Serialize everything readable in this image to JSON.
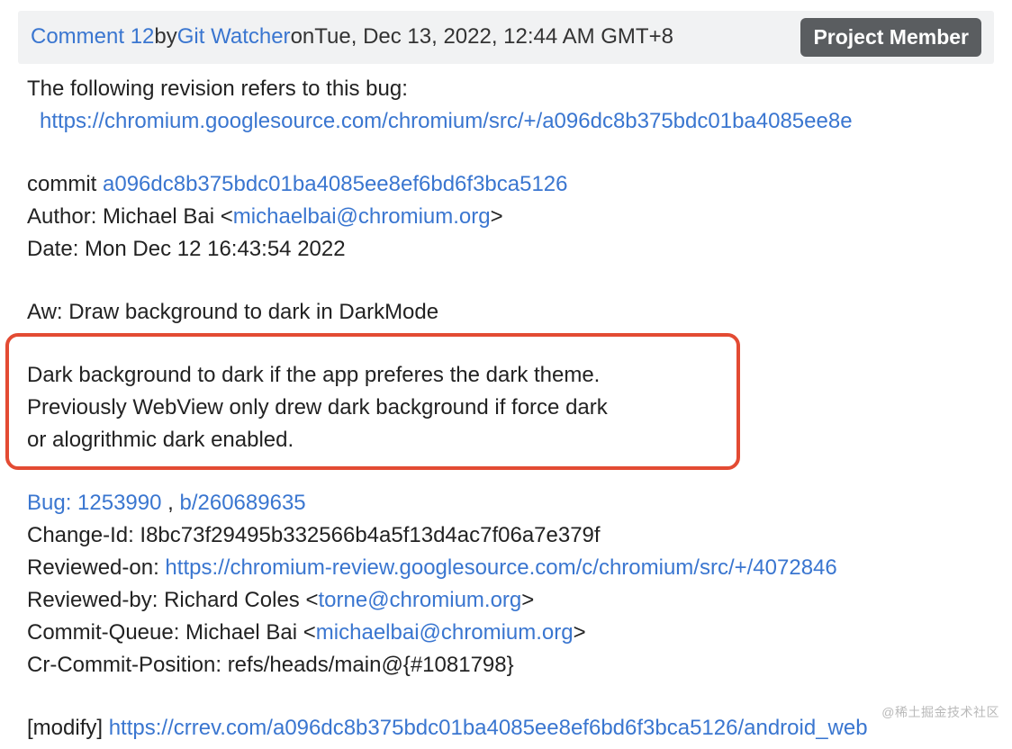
{
  "header": {
    "comment_link_text": "Comment 12",
    "by_label": " by ",
    "author_name": "Git Watcher",
    "on_label": " on ",
    "timestamp": "Tue, Dec 13, 2022, 12:44 AM GMT+8",
    "badge": "Project Member"
  },
  "body": {
    "intro": "The following revision refers to this bug:",
    "revision_url": "https://chromium.googlesource.com/chromium/src/+/a096dc8b375bdc01ba4085ee8e",
    "commit_label": "commit ",
    "commit_hash": "a096dc8b375bdc01ba4085ee8ef6bd6f3bca5126",
    "author_prefix": "Author: Michael Bai <",
    "author_email": "michaelbai@chromium.org",
    "author_suffix": ">",
    "date_line": "Date: Mon Dec 12 16:43:54 2022",
    "subject": "Aw: Draw background to dark in DarkMode",
    "desc_l1": "Dark background to dark if the app preferes the dark theme.",
    "desc_l2": "Previously WebView only drew dark background if force dark",
    "desc_l3": "or alogrithmic dark enabled.",
    "bug_link": "Bug: 1253990",
    "bug_sep": " , ",
    "bug_link2": "b/260689635",
    "change_id": "Change-Id: I8bc73f29495b332566b4a5f13d4ac7f06a7e379f",
    "reviewed_on_prefix": "Reviewed-on: ",
    "reviewed_on_url": "https://chromium-review.googlesource.com/c/chromium/src/+/4072846",
    "reviewed_by_prefix": "Reviewed-by: Richard Coles <",
    "reviewed_by_email": "torne@chromium.org",
    "reviewed_by_suffix": ">",
    "commit_queue_prefix": "Commit-Queue: Michael Bai <",
    "commit_queue_email": "michaelbai@chromium.org",
    "commit_queue_suffix": ">",
    "cr_position": "Cr-Commit-Position: refs/heads/main@{#1081798}",
    "modify_prefix": "[modify] ",
    "modify_url": "https://crrev.com/a096dc8b375bdc01ba4085ee8ef6bd6f3bca5126/android_web"
  },
  "watermark": "@稀土掘金技术社区"
}
